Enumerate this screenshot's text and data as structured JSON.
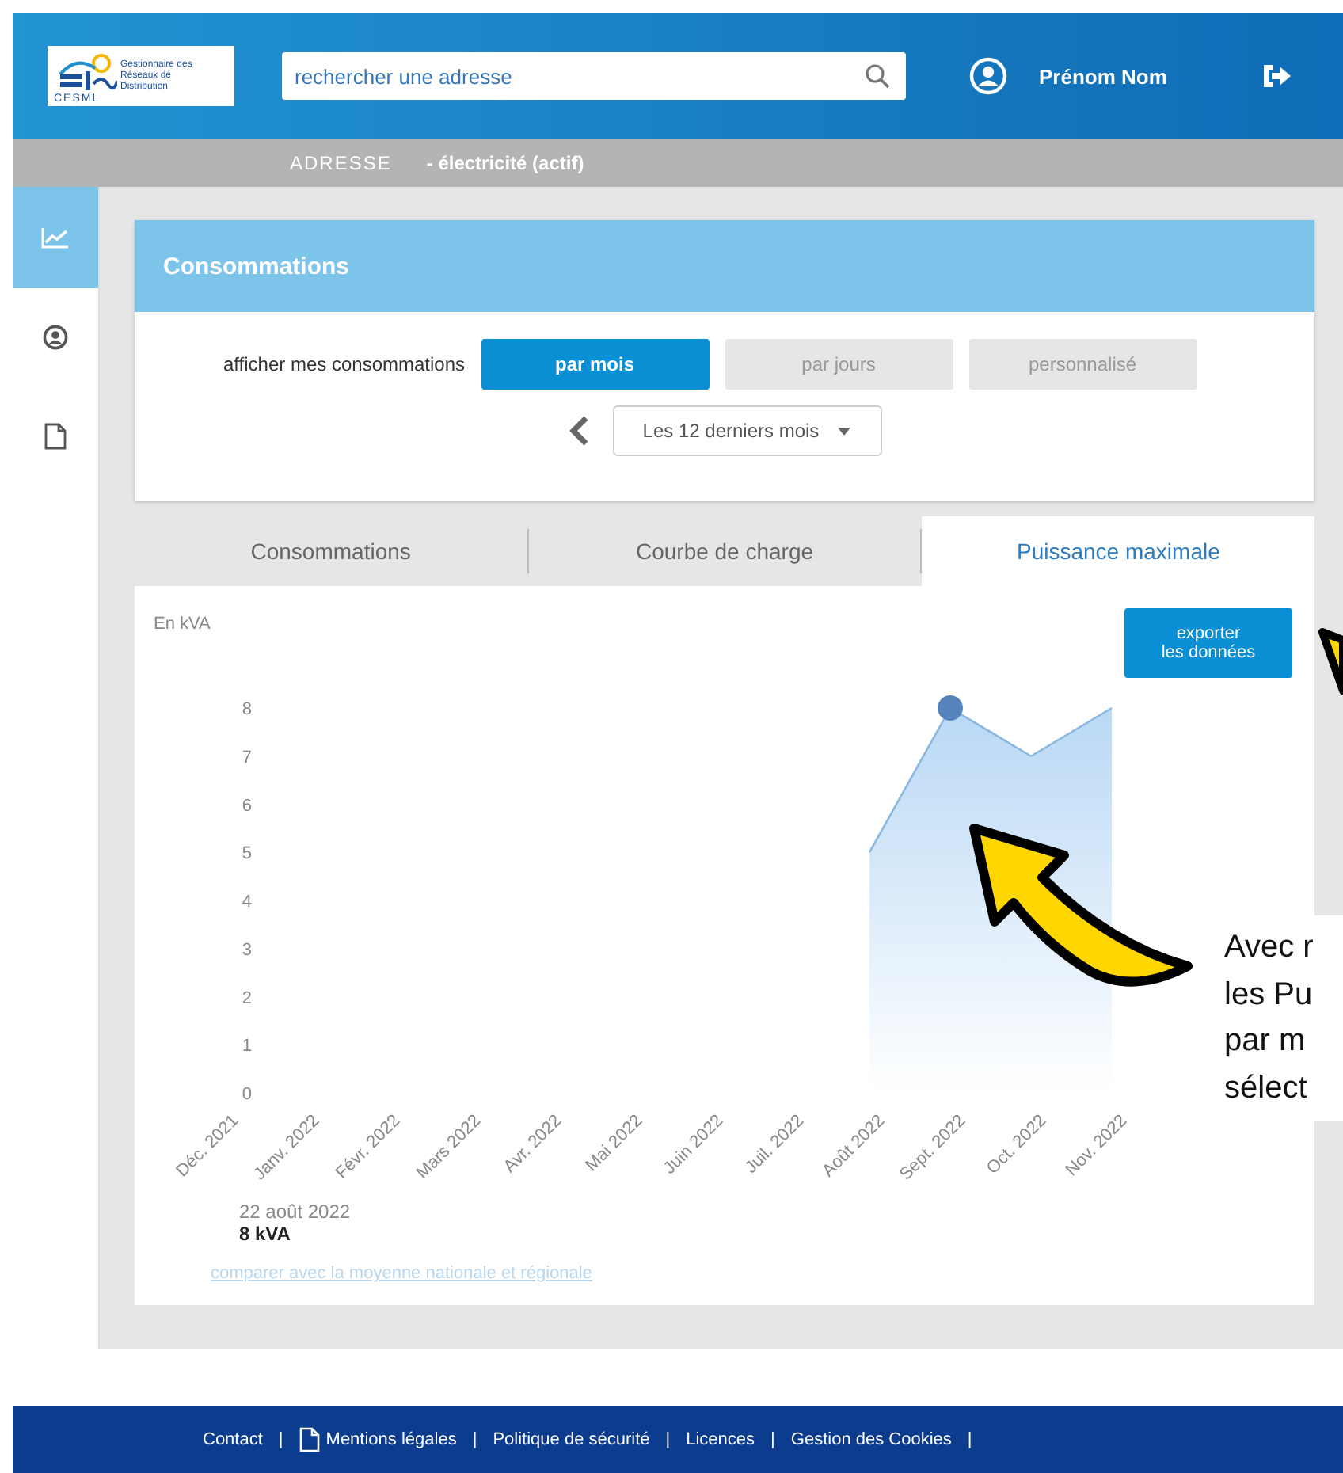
{
  "header": {
    "logo_lines": [
      "Gestionnaire des",
      "Réseaux de",
      "Distribution"
    ],
    "logo_mark": "CESML",
    "search": {
      "placeholder": "rechercher une adresse"
    },
    "user_name": "Prénom Nom"
  },
  "address_bar": {
    "label": "ADRESSE",
    "contract": "- électricité (actif)"
  },
  "sidebar": {
    "items": [
      {
        "kind": "chart",
        "selected": true
      },
      {
        "kind": "user",
        "selected": false
      },
      {
        "kind": "document",
        "selected": false
      }
    ]
  },
  "panel": {
    "title": "Consommations",
    "filter_label": "afficher mes consommations",
    "filters": [
      {
        "label": "par mois",
        "selected": true
      },
      {
        "label": "par jours",
        "selected": false
      },
      {
        "label": "personnalisé",
        "selected": false
      }
    ],
    "period": "Les 12 derniers mois"
  },
  "tabs": [
    {
      "label": "Consommations",
      "selected": false
    },
    {
      "label": "Courbe de charge",
      "selected": false
    },
    {
      "label": "Puissance maximale",
      "selected": true
    }
  ],
  "chart_panel": {
    "unit_label": "En kVA",
    "export_button": [
      "exporter",
      "les données"
    ],
    "chart_data": {
      "type": "area",
      "categories": [
        "Déc. 2021",
        "Janv. 2022",
        "Févr. 2022",
        "Mars 2022",
        "Avr. 2022",
        "Mai 2022",
        "Juin 2022",
        "Juil. 2022",
        "Août 2022",
        "Sept. 2022",
        "Oct. 2022",
        "Nov. 2022"
      ],
      "series": [
        {
          "color": "#8ab8e0",
          "values": [
            null,
            null,
            null,
            null,
            null,
            null,
            null,
            null,
            5,
            8,
            7,
            8
          ]
        }
      ],
      "ylim": [
        0,
        8
      ],
      "yticks": [
        0,
        1,
        2,
        3,
        4,
        5,
        6,
        7,
        8
      ]
    },
    "point_date": "22 août 2022",
    "point_value": "8 kVA",
    "compare_link": "comparer avec la moyenne nationale et régionale"
  },
  "footer": {
    "links": [
      {
        "label": "Contact",
        "has_icon": false
      },
      {
        "label": "Mentions légales",
        "has_icon": true
      },
      {
        "label": "Politique de sécurité",
        "has_icon": false
      },
      {
        "label": "Licences",
        "has_icon": false
      },
      {
        "label": "Gestion des Cookies",
        "has_icon": false
      }
    ],
    "separator": "|"
  },
  "annotation": {
    "lines": [
      "Avec r",
      "les Pu",
      "par m",
      "sélect"
    ]
  }
}
